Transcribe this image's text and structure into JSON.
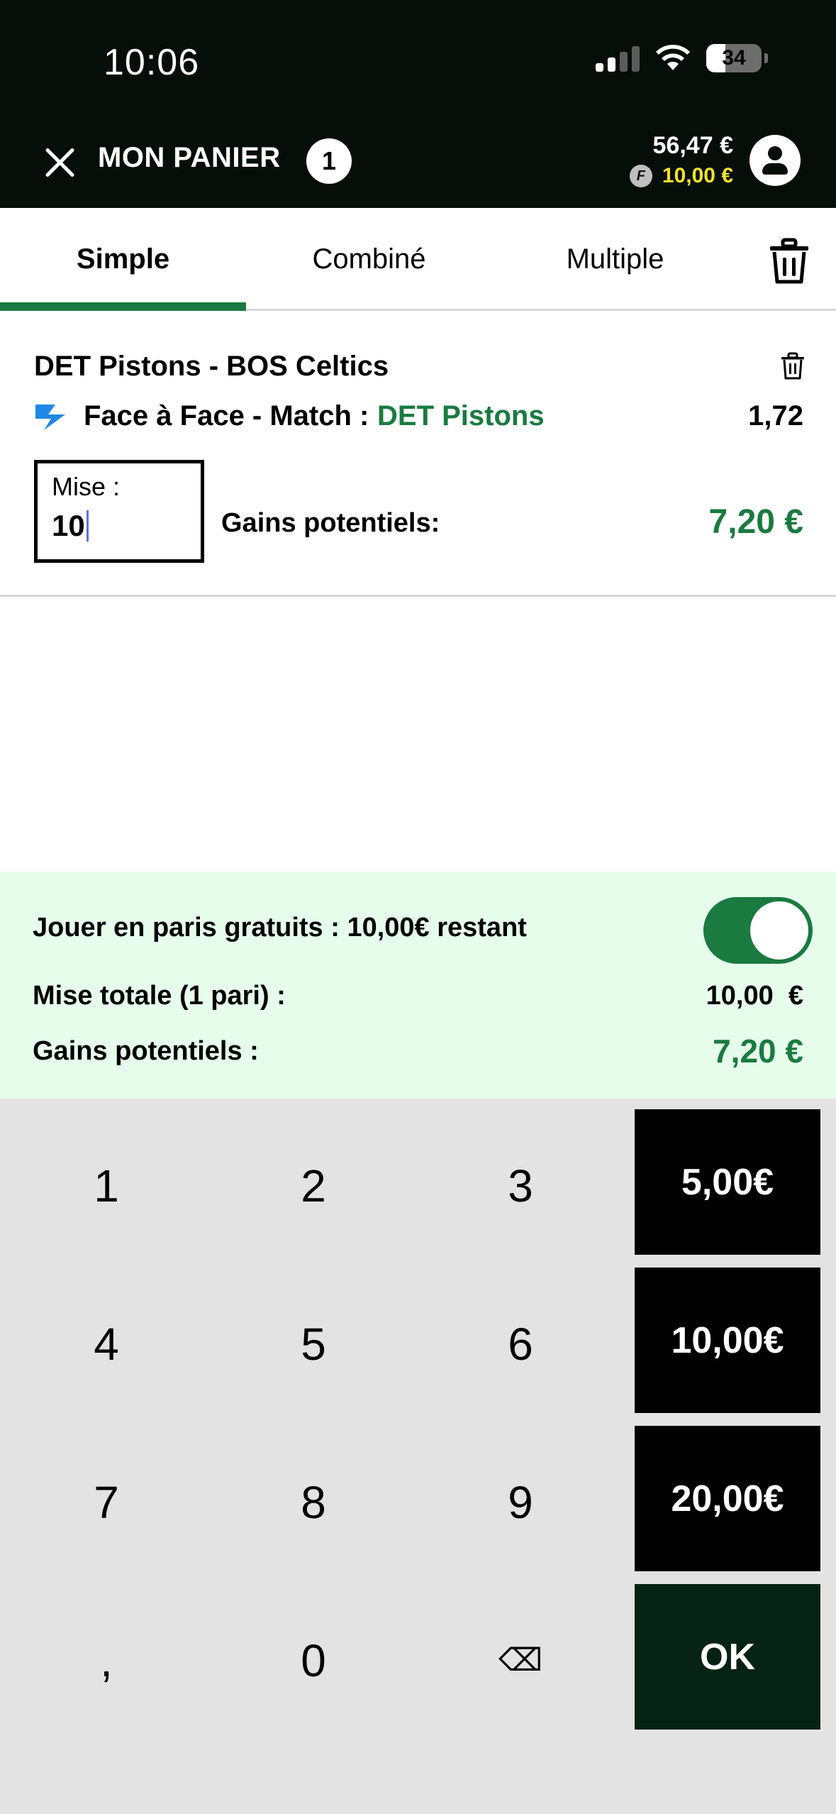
{
  "status_bar": {
    "time": "10:06",
    "battery": "34"
  },
  "header": {
    "title": "MON PANIER",
    "count": "1",
    "balance": "56,47 €",
    "free_balance": "10,00 €",
    "coin_letter": "F"
  },
  "tabs": [
    {
      "label": "Simple",
      "active": true
    },
    {
      "label": "Combiné",
      "active": false
    },
    {
      "label": "Multiple",
      "active": false
    }
  ],
  "bet": {
    "match": "DET Pistons - BOS Celtics",
    "market": "Face à Face - Match :",
    "selection": "DET Pistons",
    "odds": "1,72",
    "stake_label": "Mise :",
    "stake_value": "10",
    "gains_label": "Gains potentiels:",
    "gains_value": "7,20 €"
  },
  "summary": {
    "free_bet_label": "Jouer en paris gratuits : 10,00€ restant",
    "free_bet_enabled": true,
    "total_label": "Mise totale (1 pari) :",
    "total_value": "10,00  €",
    "potential_label": "Gains potentiels :",
    "potential_value": "7,20 €"
  },
  "keypad": {
    "keys": [
      "1",
      "2",
      "3",
      "4",
      "5",
      "6",
      "7",
      "8",
      "9",
      ",",
      "0",
      "⌫"
    ],
    "quick": [
      "5,00€",
      "10,00€",
      "20,00€"
    ],
    "ok": "OK"
  },
  "colors": {
    "header_bg": "#050e09",
    "accent_green": "#1a7a40",
    "free_bet_yellow": "#f3e12b",
    "summary_bg": "#e6fdec",
    "keypad_bg": "#e3e3e3"
  }
}
